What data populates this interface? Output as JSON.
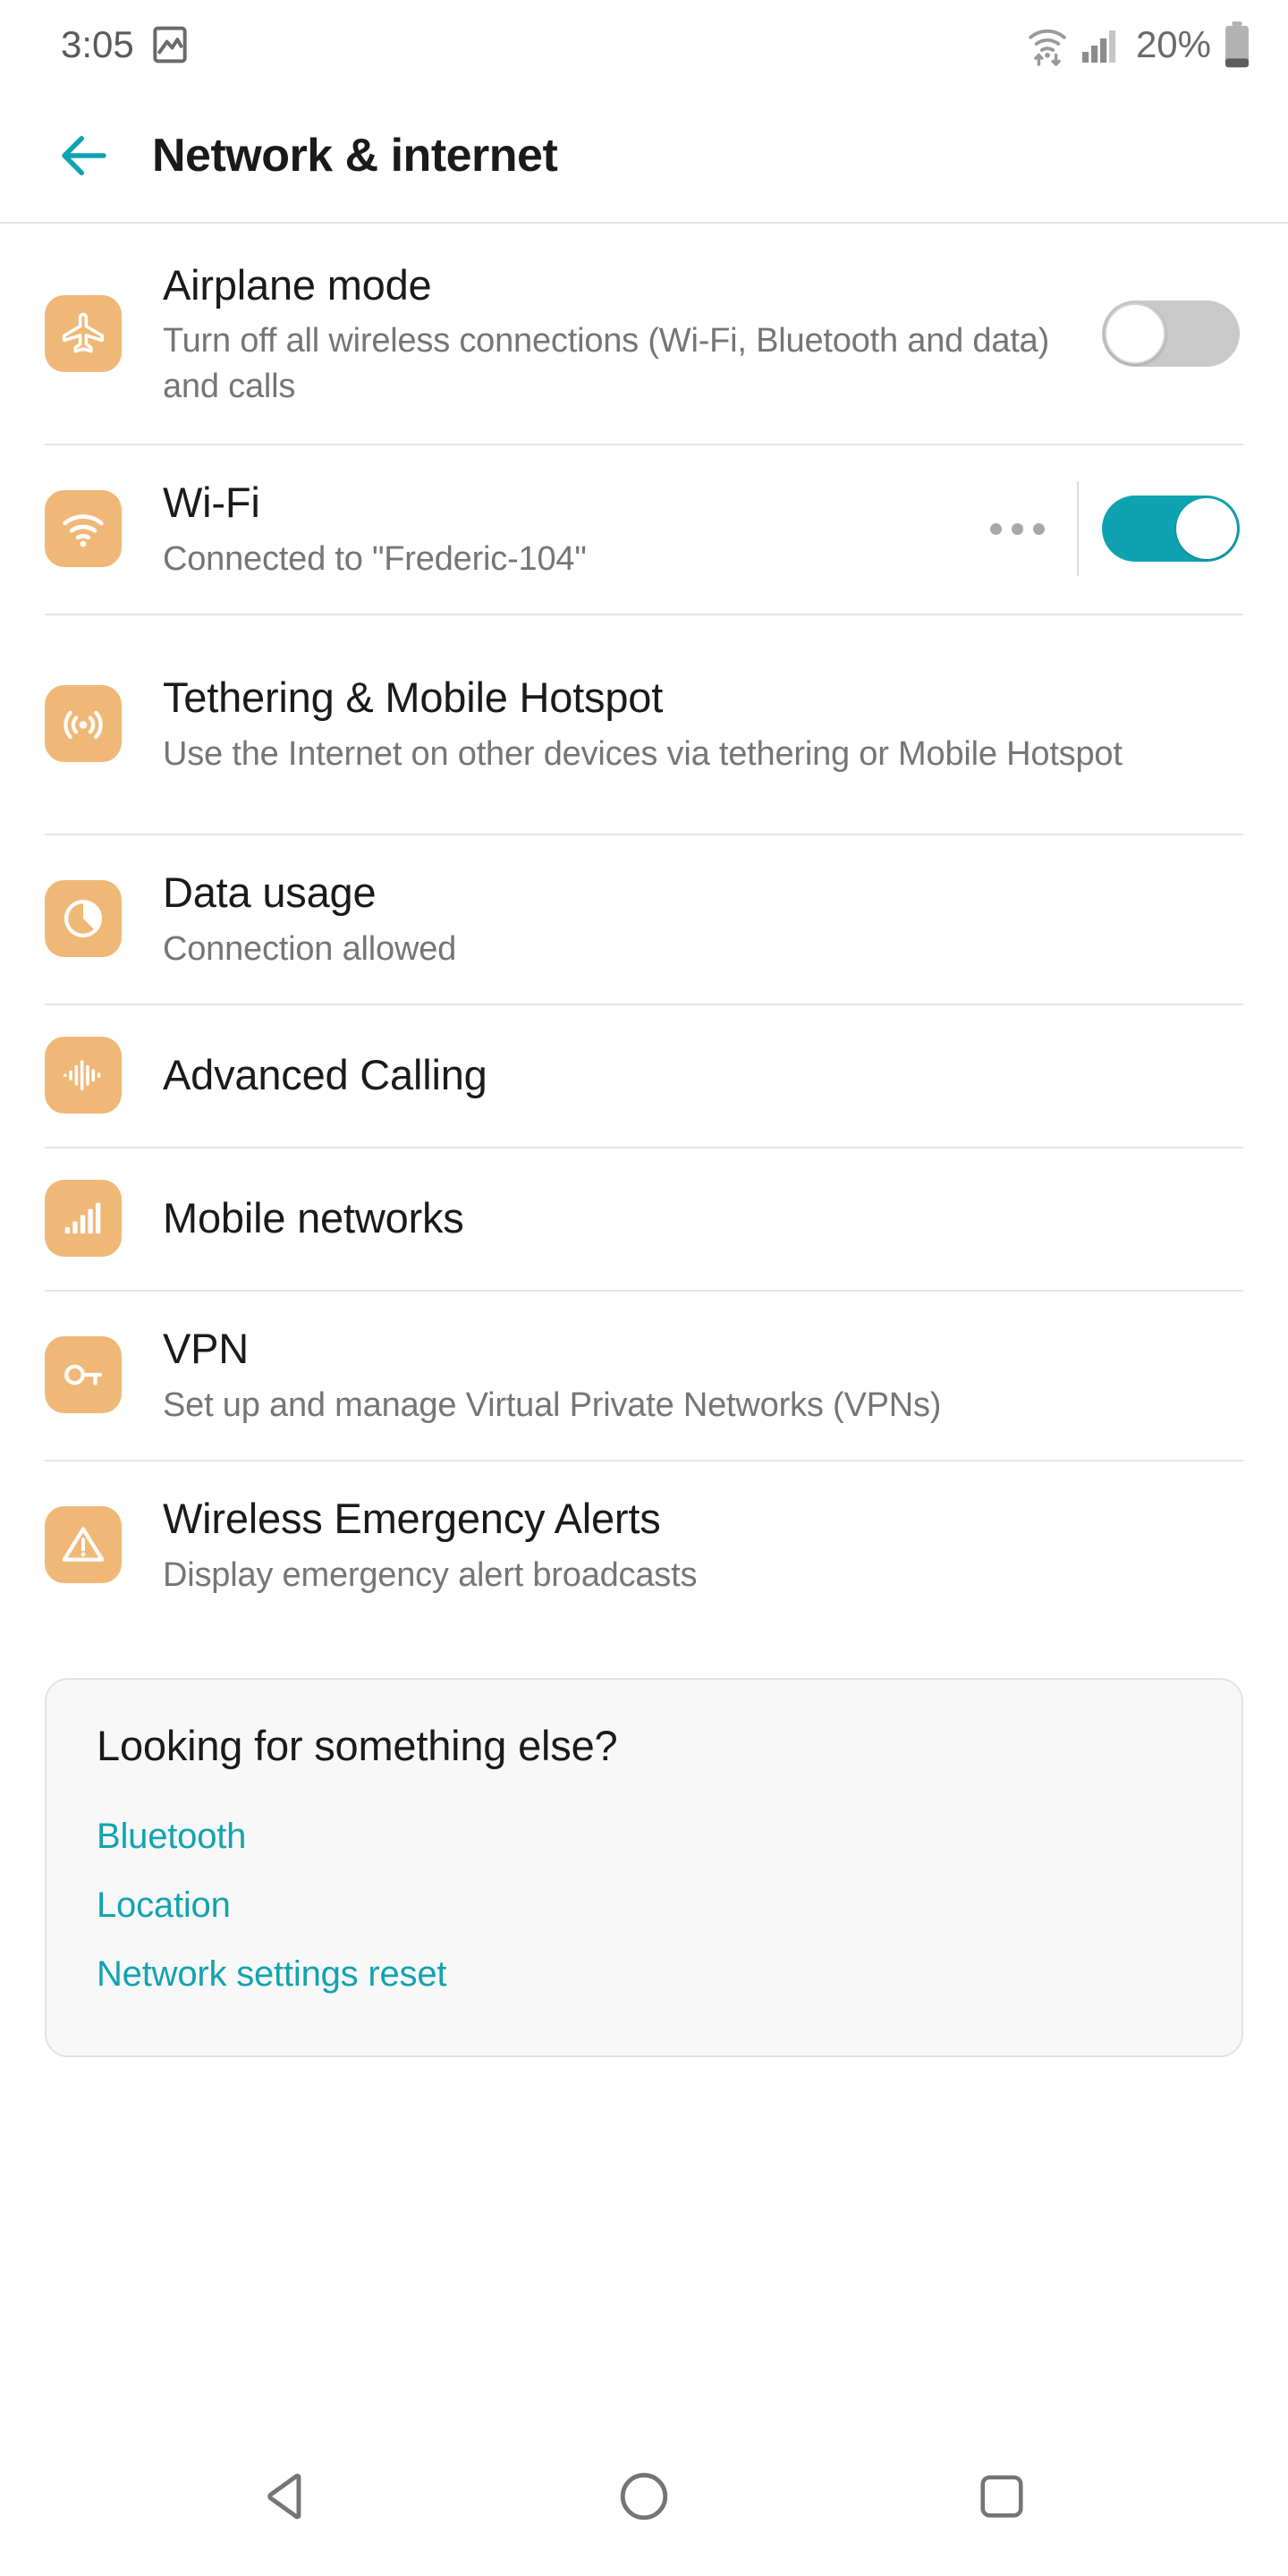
{
  "status_bar": {
    "time": "3:05",
    "screenshot_icon": "image-icon",
    "wifi_icon": "wifi-data-transfer-icon",
    "signal_icon": "cellular-signal-icon",
    "battery_percent": "20%",
    "battery_icon": "battery-low-icon"
  },
  "header": {
    "back_icon": "back-arrow-icon",
    "title": "Network & internet"
  },
  "settings": [
    {
      "icon": "airplane-icon",
      "title": "Airplane mode",
      "subtitle": "Turn off all wireless connections (Wi-Fi, Bluetooth and data) and calls",
      "control": "toggle",
      "toggle_state": "off"
    },
    {
      "icon": "wifi-icon",
      "title": "Wi-Fi",
      "subtitle": "Connected to \"Frederic-104\"",
      "control": "toggle-with-menu",
      "toggle_state": "on",
      "menu_icon": "overflow-menu-icon"
    },
    {
      "icon": "hotspot-icon",
      "title": "Tethering & Mobile Hotspot",
      "subtitle": "Use the Internet on other devices via tethering or Mobile Hotspot",
      "control": "none"
    },
    {
      "icon": "data-usage-pie-icon",
      "title": "Data usage",
      "subtitle": "Connection allowed",
      "control": "none"
    },
    {
      "icon": "waveform-icon",
      "title": "Advanced Calling",
      "subtitle": "",
      "control": "none"
    },
    {
      "icon": "signal-bars-icon",
      "title": "Mobile networks",
      "subtitle": "",
      "control": "none"
    },
    {
      "icon": "key-icon",
      "title": "VPN",
      "subtitle": "Set up and manage Virtual Private Networks (VPNs)",
      "control": "none"
    },
    {
      "icon": "warning-triangle-icon",
      "title": "Wireless Emergency Alerts",
      "subtitle": "Display emergency alert broadcasts",
      "control": "none"
    }
  ],
  "suggestions_card": {
    "title": "Looking for something else?",
    "links": [
      "Bluetooth",
      "Location",
      "Network settings reset"
    ]
  },
  "nav_bar": {
    "back": "back-triangle-icon",
    "home": "home-circle-icon",
    "recents": "recents-square-icon"
  },
  "colors": {
    "accent_teal": "#11a3b0",
    "icon_orange": "#f0b877",
    "toggle_off_gray": "#c9c9c9",
    "text_primary": "#1a1a1a",
    "text_secondary": "#757575"
  }
}
